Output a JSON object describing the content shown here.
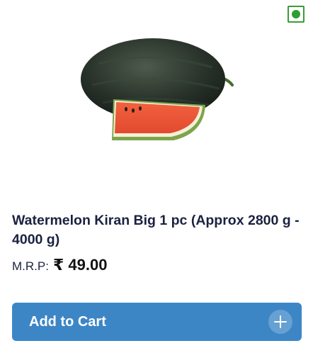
{
  "product": {
    "title": "Watermelon Kiran Big 1 pc (Approx 2800 g - 4000 g)",
    "mrp_label": "M.R.P:",
    "price": "₹ 49.00",
    "image_icon": "watermelon-image",
    "veg_indicator": "veg-indicator-icon"
  },
  "cart_button": {
    "label": "Add to Cart",
    "icon": "plus-icon"
  },
  "colors": {
    "button_bg": "#3d86c6",
    "veg_green": "#2f9e2f",
    "title_text": "#1b2240"
  }
}
